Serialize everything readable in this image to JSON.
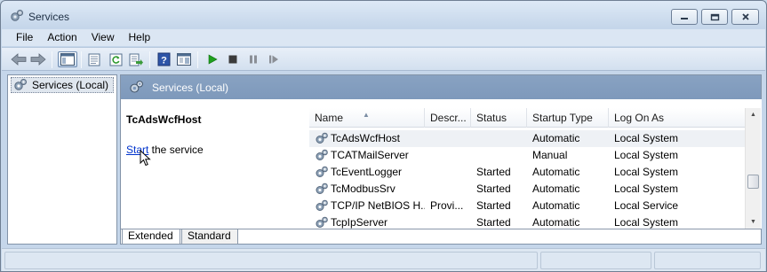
{
  "window": {
    "title": "Services",
    "icon": "gears-icon"
  },
  "menu": [
    "File",
    "Action",
    "View",
    "Help"
  ],
  "toolbar": {
    "buttons": [
      "back-icon",
      "forward-icon",
      "show-hide-console-tree-icon",
      "properties-icon",
      "refresh-icon",
      "export-list-icon",
      "help-icon",
      "show-action-pane-icon",
      "start-service-icon",
      "stop-service-icon",
      "pause-service-icon",
      "restart-service-icon"
    ]
  },
  "tree": {
    "item": "Services (Local)"
  },
  "panel": {
    "title": "Services (Local)"
  },
  "detail": {
    "service_name": "TcAdsWcfHost",
    "start_link": "Start",
    "start_suffix": " the service"
  },
  "columns": {
    "name": "Name",
    "description": "Descr...",
    "status": "Status",
    "startup_type": "Startup Type",
    "log_on_as": "Log On As"
  },
  "rows": [
    {
      "name": "TcAdsWcfHost",
      "description": "",
      "status": "",
      "startup_type": "Automatic",
      "log_on_as": "Local System"
    },
    {
      "name": "TCATMailServer",
      "description": "",
      "status": "",
      "startup_type": "Manual",
      "log_on_as": "Local System"
    },
    {
      "name": "TcEventLogger",
      "description": "",
      "status": "Started",
      "startup_type": "Automatic",
      "log_on_as": "Local System"
    },
    {
      "name": "TcModbusSrv",
      "description": "",
      "status": "Started",
      "startup_type": "Automatic",
      "log_on_as": "Local System"
    },
    {
      "name": "TCP/IP NetBIOS H...",
      "description": "Provi...",
      "status": "Started",
      "startup_type": "Automatic",
      "log_on_as": "Local Service"
    },
    {
      "name": "TcpIpServer",
      "description": "",
      "status": "Started",
      "startup_type": "Automatic",
      "log_on_as": "Local System"
    }
  ],
  "tabs": [
    "Extended",
    "Standard"
  ],
  "colors": {
    "header_band": "#7e99bb",
    "link": "#0033cc",
    "play": "#1ea01e"
  }
}
